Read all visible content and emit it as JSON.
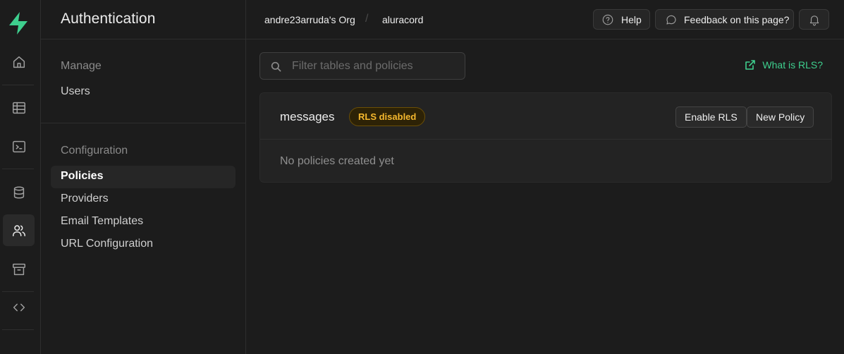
{
  "sidebar_title": "Authentication",
  "rail": {
    "items": [
      {
        "icon": "home-icon"
      },
      {
        "icon": "table-editor-icon"
      },
      {
        "icon": "sql-editor-icon"
      },
      {
        "icon": "database-icon"
      },
      {
        "icon": "users-icon",
        "active": true
      },
      {
        "icon": "storage-icon"
      },
      {
        "icon": "api-icon"
      }
    ]
  },
  "sidebar": {
    "manage_label": "Manage",
    "manage_items": [
      "Users"
    ],
    "config_label": "Configuration",
    "config_items": [
      "Policies",
      "Providers",
      "Email Templates",
      "URL Configuration"
    ],
    "active_item": "Policies"
  },
  "topbar": {
    "org": "andre23arruda's Org",
    "separator": "/",
    "project": "aluracord",
    "help_label": "Help",
    "feedback_label": "Feedback on this page?"
  },
  "search": {
    "placeholder": "Filter tables and policies",
    "value": ""
  },
  "rls_link": "What is RLS?",
  "table_card": {
    "table_name": "messages",
    "badge": "RLS disabled",
    "enable_button": "Enable RLS",
    "new_policy_button": "New Policy",
    "empty_message": "No policies created yet"
  },
  "colors": {
    "accent": "#3ecf8e",
    "warning": "#f5b82e",
    "background": "#1c1c1c"
  }
}
